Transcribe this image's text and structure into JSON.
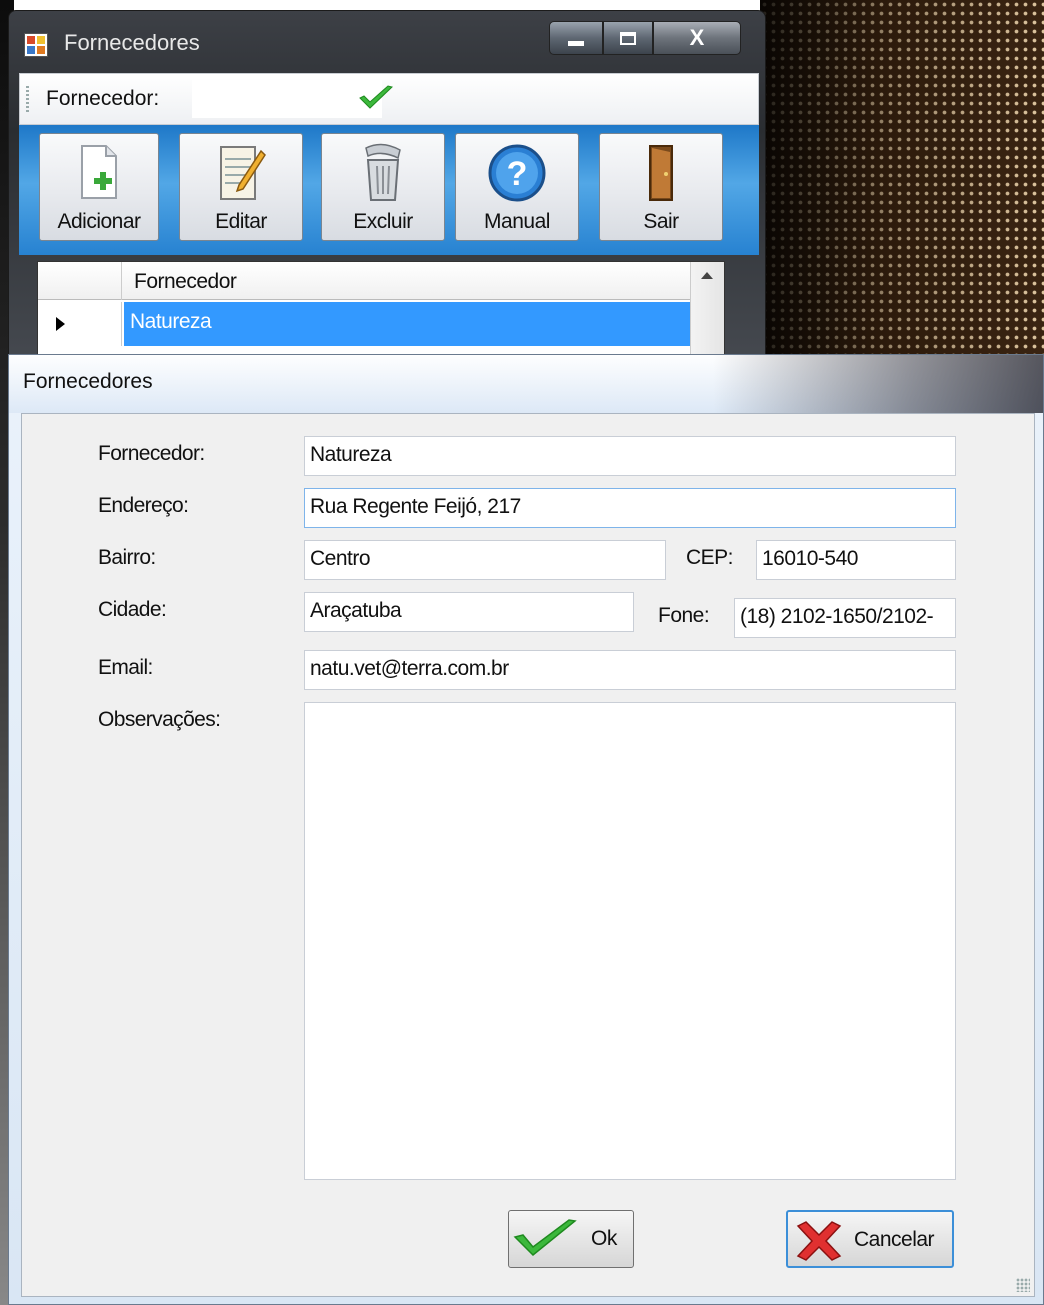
{
  "back_window": {
    "title": "Fornecedores",
    "close_glyph": "X",
    "toolstrip": {
      "fornecedor_label": "Fornecedor:",
      "fornecedor_value": ""
    },
    "toolbar": {
      "buttons": [
        {
          "label": "Adicionar",
          "icon": "add-document-icon"
        },
        {
          "label": "Editar",
          "icon": "edit-notepad-icon"
        },
        {
          "label": "Excluir",
          "icon": "trash-can-icon"
        },
        {
          "label": "Manual",
          "icon": "help-icon"
        },
        {
          "label": "Sair",
          "icon": "exit-door-icon"
        }
      ]
    },
    "grid": {
      "columns": [
        "Fornecedor"
      ],
      "rows": [
        [
          "Natureza"
        ]
      ]
    }
  },
  "dialog": {
    "title": "Fornecedores",
    "fields": {
      "fornecedor": {
        "label": "Fornecedor:",
        "value": "Natureza"
      },
      "endereco": {
        "label": "Endereço:",
        "value": "Rua Regente Feijó, 217"
      },
      "bairro": {
        "label": "Bairro:",
        "value": "Centro"
      },
      "cep": {
        "label": "CEP:",
        "value": "16010-540"
      },
      "cidade": {
        "label": "Cidade:",
        "value": "Araçatuba"
      },
      "fone": {
        "label": "Fone:",
        "value": "(18) 2102-1650/2102-"
      },
      "email": {
        "label": "Email:",
        "value": "natu.vet@terra.com.br"
      },
      "observacoes": {
        "label": "Observações:",
        "value": ""
      }
    },
    "buttons": {
      "ok": "Ok",
      "cancel": "Cancelar"
    }
  },
  "colors": {
    "selection": "#3399ff",
    "toolbar_blue": "#2782d1",
    "check_green": "#3cb83c",
    "cancel_red": "#e03030"
  }
}
